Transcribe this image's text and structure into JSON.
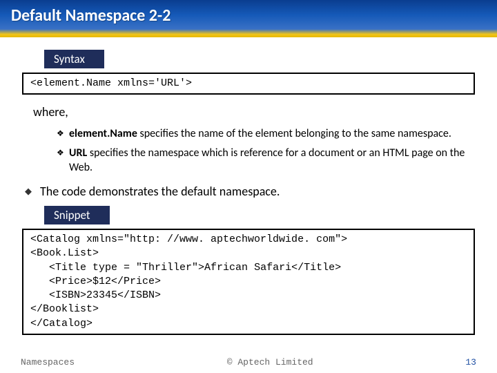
{
  "title": "Default Namespace 2-2",
  "labels": {
    "syntax": "Syntax",
    "snippet": "Snippet"
  },
  "syntax_code": "<element.Name xmlns='URL'>",
  "where_label": "where,",
  "bullets": [
    {
      "bold": "element.Name",
      "rest": " specifies the name of the element belonging to the same namespace."
    },
    {
      "bold": "URL",
      "rest": " specifies the namespace which is reference for a document or an HTML page on the Web."
    }
  ],
  "main_point": "The code demonstrates the default namespace.",
  "snippet_code": "<Catalog xmlns=\"http: //www. aptechworldwide. com\">\n<Book.List>\n   <Title type = \"Thriller\">African Safari</Title>\n   <Price>$12</Price>\n   <ISBN>23345</ISBN>\n</Booklist>\n</Catalog>",
  "footer": {
    "left": "Namespaces",
    "center": "© Aptech Limited",
    "page": "13"
  }
}
